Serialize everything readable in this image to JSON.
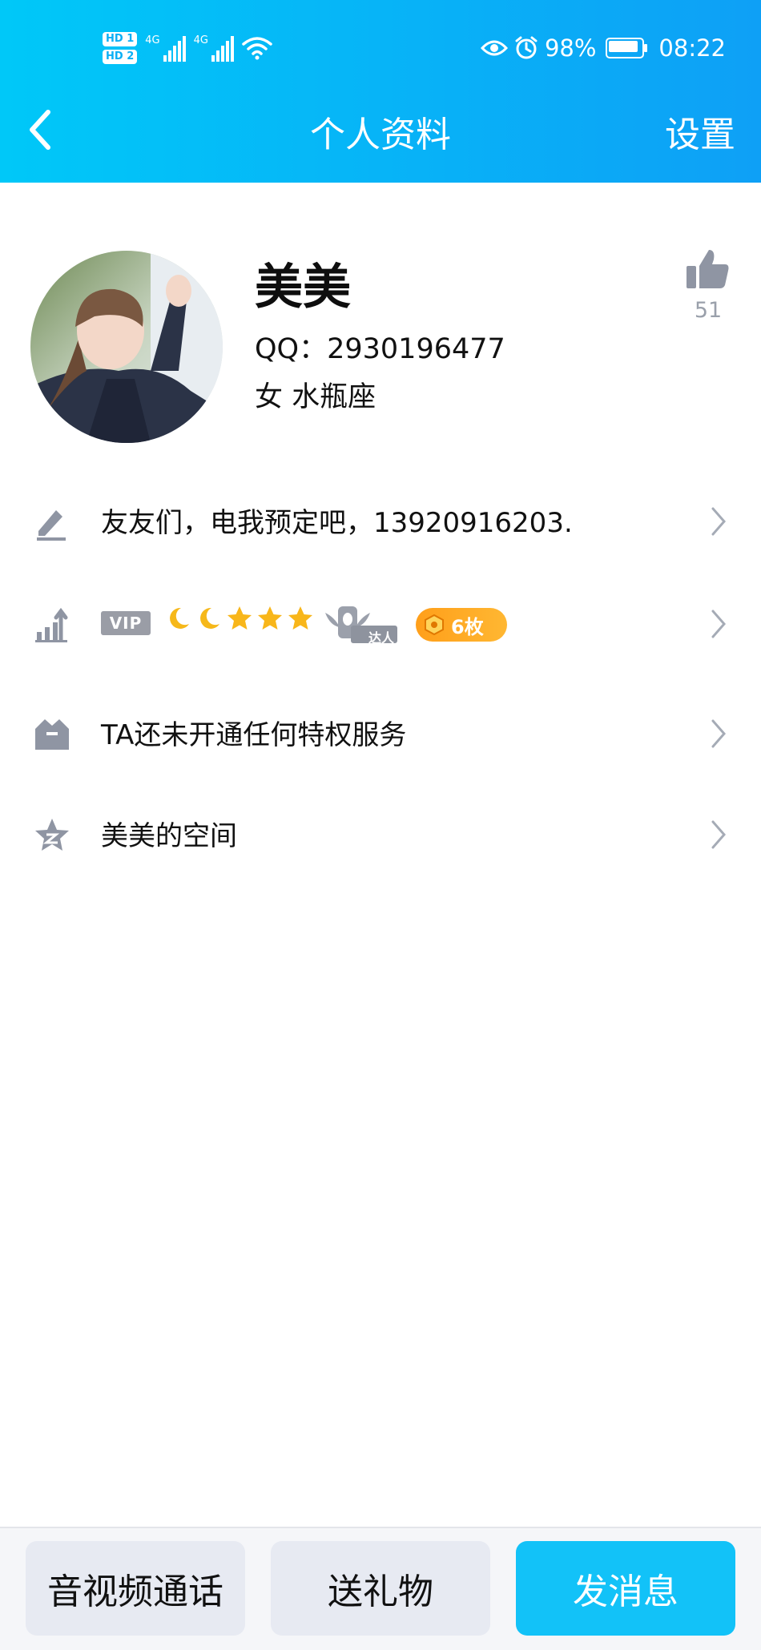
{
  "status_bar": {
    "hd1": "HD 1",
    "hd2": "HD 2",
    "net1": "4G",
    "net2": "4G",
    "battery_percent": "98%",
    "time": "08:22"
  },
  "nav": {
    "title": "个人资料",
    "settings": "设置"
  },
  "profile": {
    "name": "美美",
    "qq": "QQ：2930196477",
    "gender_zodiac": "女  水瓶座",
    "likes": "51"
  },
  "rows": {
    "signature": "友友们，电我预定吧，13920916203.",
    "vip_label": "VIP",
    "level_icons": [
      "moon-icon",
      "moon-icon",
      "star-icon",
      "star-icon",
      "star-icon"
    ],
    "expert_label": "达人",
    "medal_count": "6枚",
    "privilege": "TA还未开通任何特权服务",
    "space": "美美的空间"
  },
  "bottom": {
    "call": "音视频通话",
    "gift": "送礼物",
    "message": "发消息"
  },
  "colors": {
    "header_start": "#00c8f8",
    "header_end": "#0ea0f6",
    "primary_button": "#12c2f8",
    "medal": "#ffa51f",
    "icon_grey": "#8f95a3"
  }
}
